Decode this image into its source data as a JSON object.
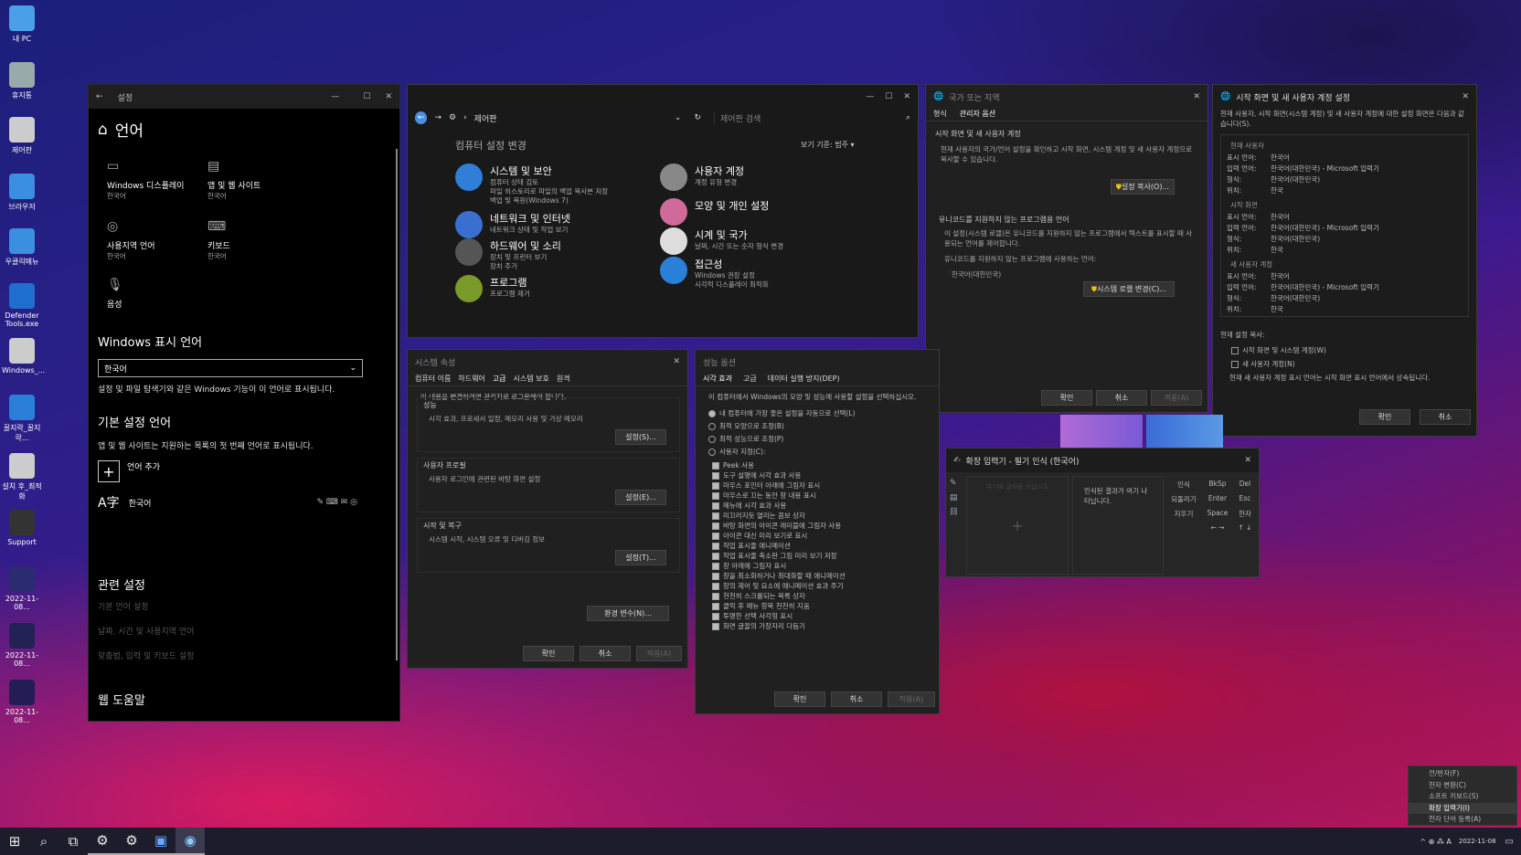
{
  "desktop_icons": [
    {
      "label": "내 PC",
      "icon": "monitor-icon",
      "color": "#4a9fe8"
    },
    {
      "label": "휴지통",
      "icon": "recycle-bin-icon",
      "color": "#9aa"
    },
    {
      "label": "제어판",
      "icon": "gear-icon",
      "color": "#ccc"
    },
    {
      "label": "브라우저",
      "icon": "file-icon",
      "color": "#3b8fe0"
    },
    {
      "label": "우클릭메뉴",
      "icon": "file-icon",
      "color": "#3b8fe0"
    },
    {
      "label": "Defender Tools.exe",
      "icon": "shield-icon",
      "color": "#1e6fd0"
    },
    {
      "label": "Windows_...",
      "icon": "gear-icon",
      "color": "#ccc"
    },
    {
      "label": "꿀지락_꿀지락...",
      "icon": "ie-icon",
      "color": "#2a7fd8"
    },
    {
      "label": "설치 후_최적화",
      "icon": "gear-icon",
      "color": "#ccc"
    },
    {
      "label": "Support",
      "icon": "monitor-icon",
      "color": "#333"
    },
    {
      "label": "2022-11-08...",
      "icon": "image-icon",
      "color": "#2b2b70"
    },
    {
      "label": "2022-11-08...",
      "icon": "image-icon",
      "color": "#222255"
    },
    {
      "label": "2022-11-08...",
      "icon": "image-icon",
      "color": "#221e55"
    }
  ],
  "settings": {
    "title": "설정",
    "header": "언어",
    "tiles": [
      {
        "label": "Windows 디스플레이",
        "sub": "한국어",
        "icon": "display-icon"
      },
      {
        "label": "앱 및 웹 사이트",
        "sub": "한국어",
        "icon": "app-window-icon"
      },
      {
        "label": "사용지역 언어",
        "sub": "한국어",
        "icon": "region-icon"
      },
      {
        "label": "키보드",
        "sub": "한국어",
        "icon": "keyboard-icon"
      },
      {
        "label": "음성",
        "sub": "",
        "icon": "microphone-icon"
      }
    ],
    "display_lang_heading": "Windows 표시 언어",
    "display_lang_value": "한국어",
    "display_lang_desc": "설정 및 파일 탐색기와 같은 Windows 기능이 이 언어로 표시됩니다.",
    "pref_heading": "기본 설정 언어",
    "pref_desc": "앱 및 웹 사이트는 지원하는 목록의 첫 번째 언어로 표시됩니다.",
    "add_lang": "언어 추가",
    "lang_item": "한국어",
    "related_heading": "관련 설정",
    "related": [
      "기본 언어 설정",
      "날짜, 시간 및 사용지역 언어",
      "맞춤법, 입력 및 키보드 설정"
    ],
    "help_heading": "웹 도움말"
  },
  "control_panel": {
    "breadcrumb": "제어판",
    "search_placeholder": "제어판 검색",
    "heading": "컴퓨터 설정 변경",
    "view_by": "보기 기준:",
    "view_value": "범주 ▾",
    "categories": [
      {
        "title": "시스템 및 보안",
        "lines": [
          "컴퓨터 상태 검토",
          "파일 히스토리로 파일의 백업 복사본 저장",
          "백업 및 복원(Windows 7)"
        ],
        "color": "#2f7fd8"
      },
      {
        "title": "네트워크 및 인터넷",
        "lines": [
          "네트워크 상태 및 작업 보기"
        ],
        "color": "#3a6fd0"
      },
      {
        "title": "하드웨어 및 소리",
        "lines": [
          "장치 및 프린터 보기",
          "장치 추가"
        ],
        "color": "#555"
      },
      {
        "title": "프로그램",
        "lines": [
          "프로그램 제거"
        ],
        "color": "#7a9a2a"
      },
      {
        "title": "사용자 계정",
        "lines": [
          "계정 유형 변경"
        ],
        "color": "#888"
      },
      {
        "title": "모양 및 개인 설정",
        "lines": [],
        "color": "#d06a9a"
      },
      {
        "title": "시계 및 국가",
        "lines": [
          "날짜, 시간 또는 숫자 형식 변경"
        ],
        "color": "#ddd"
      },
      {
        "title": "접근성",
        "lines": [
          "Windows 권장 설정",
          "시각적 디스플레이 최적화"
        ],
        "color": "#2a7fd8"
      }
    ]
  },
  "region": {
    "title": "국가 또는 지역",
    "tabs": [
      "형식",
      "관리자 옵션"
    ],
    "sec1_title": "시작 화면 및 새 사용자 계정",
    "sec1_desc": "현재 사용자의 국가/언어 설정을 확인하고 시작 화면, 시스템 계정 및 새 사용자 계정으로 복사할 수 있습니다.",
    "copy_btn": "설정 복사(O)...",
    "sec2_title": "유니코드를 지원하지 않는 프로그램용 언어",
    "sec2_desc": "이 설정(시스템 로캘)은 유니코드를 지원하지 않는 프로그램에서 텍스트를 표시할 때 사용되는 언어를 제어합니다.",
    "current_label": "유니코드를 지원하지 않는 프로그램에 사용하는 언어:",
    "current_value": "한국어(대한민국)",
    "locale_btn": "시스템 로캘 변경(C)...",
    "ok": "확인",
    "cancel": "취소",
    "apply": "적용(A)"
  },
  "welcome": {
    "title": "시작 화면 및 새 사용자 계정 설정",
    "desc": "현재 사용자, 시작 화면(시스템 계정) 및 새 사용자 계정에 대한 설정 화면은 다음과 같습니다(S).",
    "groups": [
      {
        "name": "현재 사용자",
        "rows": [
          [
            "표시 언어:",
            "한국어"
          ],
          [
            "입력 언어:",
            "한국어(대한민국) - Microsoft 입력기"
          ],
          [
            "형식:",
            "한국어(대한민국)"
          ],
          [
            "위치:",
            "한국"
          ]
        ]
      },
      {
        "name": "시작 화면",
        "rows": [
          [
            "표시 언어:",
            "한국어"
          ],
          [
            "입력 언어:",
            "한국어(대한민국) - Microsoft 입력기"
          ],
          [
            "형식:",
            "한국어(대한민국)"
          ],
          [
            "위치:",
            "한국"
          ]
        ]
      },
      {
        "name": "새 사용자 계정",
        "rows": [
          [
            "표시 언어:",
            "한국어"
          ],
          [
            "입력 언어:",
            "한국어(대한민국) - Microsoft 입력기"
          ],
          [
            "형식:",
            "한국어(대한민국)"
          ],
          [
            "위치:",
            "한국"
          ]
        ]
      }
    ],
    "copy_label": "현재 설정 복사:",
    "check1": "시작 화면 및 시스템 계정(W)",
    "check2": "새 사용자 계정(N)",
    "note": "현재 새 사용자 계정 표시 언어는 시작 화면 표시 언어에서 상속됩니다.",
    "ok": "확인",
    "cancel": "취소"
  },
  "sysprop": {
    "title": "시스템 속성",
    "tabs": [
      "컴퓨터 이름",
      "하드웨어",
      "고급",
      "시스템 보호",
      "원격"
    ],
    "admin_note": "이 내용을 변경하려면 관리자로 로그온해야 합니다.",
    "sections": [
      {
        "title": "성능",
        "desc": "시각 효과, 프로세서 일정, 메모리 사용 및 가상 메모리",
        "btn": "설정(S)..."
      },
      {
        "title": "사용자 프로필",
        "desc": "사용자 로그인에 관련된 바탕 화면 설정",
        "btn": "설정(E)..."
      },
      {
        "title": "시작 및 복구",
        "desc": "시스템 시작, 시스템 오류 및 디버깅 정보",
        "btn": "설정(T)..."
      }
    ],
    "env_btn": "환경 변수(N)...",
    "ok": "확인",
    "cancel": "취소",
    "apply": "적용(A)"
  },
  "perf": {
    "title": "성능 옵션",
    "tabs": [
      "시각 효과",
      "고급",
      "데이터 실행 방지(DEP)"
    ],
    "desc": "이 컴퓨터에서 Windows의 모양 및 성능에 사용할 설정을 선택하십시오.",
    "radios": [
      "내 컴퓨터에 가장 좋은 설정을 자동으로 선택(L)",
      "최적 모양으로 조정(B)",
      "최적 성능으로 조정(P)",
      "사용자 지정(C):"
    ],
    "checks": [
      "Peek 사용",
      "도구 설명에 시각 효과 사용",
      "마우스 포인터 아래에 그림자 표시",
      "마우스로 끄는 동안 창 내용 표시",
      "메뉴에 시각 효과 사용",
      "미끄러지듯 열리는 콤보 상자",
      "바탕 화면의 아이콘 레이블에 그림자 사용",
      "아이콘 대신 미리 보기로 표시",
      "작업 표시줄 애니메이션",
      "작업 표시줄 축소판 그림 미리 보기 저장",
      "창 아래에 그림자 표시",
      "창을 최소화하거나 최대화할 때 애니메이션",
      "창의 제어 및 요소에 애니메이션 효과 주기",
      "천천히 스크롤되는 목록 상자",
      "클릭 후 메뉴 항목 천천히 지움",
      "투명한 선택 사각형 표시",
      "화면 글꼴의 가장자리 다듬기"
    ],
    "ok": "확인",
    "cancel": "취소",
    "apply": "적용(A)"
  },
  "ime": {
    "title": "확장 입력기 - 필기 인식 (한국어)",
    "placeholder": "여기에 글자를 쓰십시오",
    "result_text": "인식된 결과가 여기 나타납니다.",
    "keys_col1": [
      "인식",
      "되돌리기",
      "지우기"
    ],
    "keys_col2": [
      "BkSp",
      "Enter",
      "Space",
      "←  →"
    ],
    "keys_col3": [
      "Del",
      "Esc",
      "한자",
      "↑  ↓"
    ]
  },
  "context_menu": {
    "items": [
      "전/반자(F)",
      "한자 변환(C)",
      "소프트 키보드(S)",
      "확장 입력기(I)",
      "한자 단어 등록(A)"
    ],
    "highlight_index": 3
  },
  "taskbar": {
    "tray": "^  ⊕  ⁂  A",
    "date": "2022-11-08"
  }
}
